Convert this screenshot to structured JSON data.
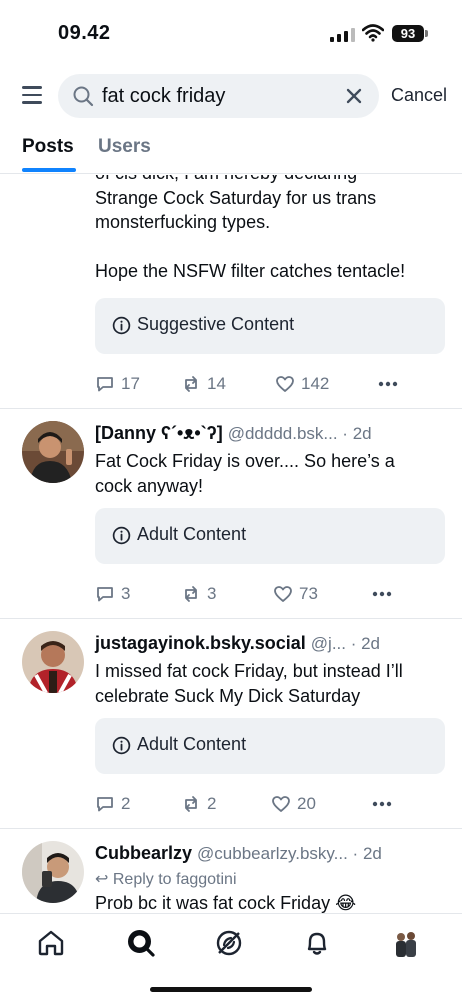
{
  "status_bar": {
    "time": "09.42",
    "battery": "93"
  },
  "search": {
    "query": "fat cock friday",
    "cancel_label": "Cancel"
  },
  "tabs": [
    {
      "label": "Posts",
      "active": true
    },
    {
      "label": "Users",
      "active": false
    }
  ],
  "posts": [
    {
      "text_lines": [
        "of cis dick, I am hereby declaring",
        "Strange Cock Saturday for us trans",
        "monsterfucking types.",
        "",
        "Hope the NSFW filter catches tentacle!"
      ],
      "label": "Suggestive Content",
      "replies": "17",
      "reposts": "14",
      "likes": "142"
    },
    {
      "author": "[Danny ʕ´•ᴥ•`ʔ]",
      "handle": "@ddddd.bsk... · 2d",
      "text_lines": [
        "Fat Cock Friday is over.... So here’s a",
        "cock anyway!"
      ],
      "label": "Adult Content",
      "replies": "3",
      "reposts": "3",
      "likes": "73"
    },
    {
      "author": "justagayinok.bsky.social",
      "handle": "@j... · 2d",
      "text_lines": [
        "I missed fat cock Friday, but instead I’ll",
        "celebrate Suck My Dick Saturday"
      ],
      "label": "Adult Content",
      "replies": "2",
      "reposts": "2",
      "likes": "20"
    },
    {
      "author": "Cubbearlzy",
      "handle": "@cubbearlzy.bsky... · 2d",
      "reply_to": "Reply to faggotini",
      "text_lines": [
        "Prob bc it was fat cock Friday 😂"
      ]
    }
  ],
  "colors": {
    "accent": "#1083fe",
    "muted": "#6b7685",
    "label_bg": "#eef1f4"
  },
  "bottom_nav": [
    "home-icon",
    "search-icon",
    "feeds-icon",
    "notifications-icon",
    "profile-avatar"
  ]
}
